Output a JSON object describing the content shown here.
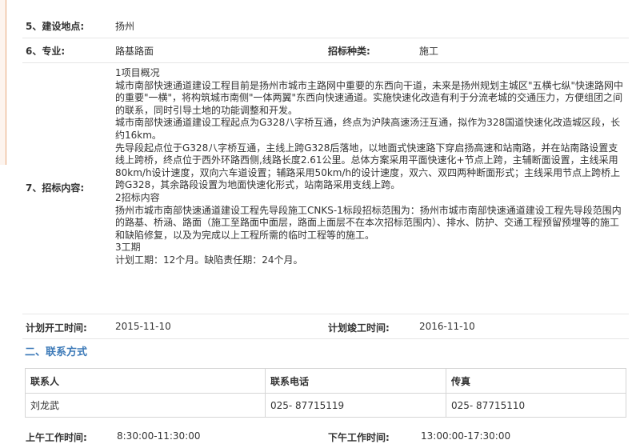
{
  "fields": {
    "location": {
      "label": "5、建设地点:",
      "value": "扬州"
    },
    "major": {
      "label": "6、专业:",
      "value": "路基路面"
    },
    "bid_type": {
      "label": "招标种类:",
      "value": "施工"
    },
    "content": {
      "label": "7、招标内容:",
      "paragraphs": [
        "1项目概况",
        "城市南部快速通道建设工程目前是扬州市城市主路网中重要的东西向干道，未来是扬州规划主城区\"五横七纵\"快速路网中的重要\"一横\"，将构筑城市南侧\"一体两翼\"东西向快速通道。实施快速化改造有利于分流老城的交通压力，方便组团之间的联系，同时引导土地的功能调整和开发。",
        "城市南部快速通道建设工程起点为G328八字桥互通，终点为沪陕高速汤汪互通，拟作为328国道快速化改造城区段，长约16km。",
        "先导段起点位于G328八字桥互通，主线上跨G328后落地，以地面式快速路下穿启扬高速和站南路，并在站南路设置支线上跨桥，终点位于西外环路西侧,线路长度2.61公里。总体方案采用平面快速化+节点上跨，主辅断面设置，主线采用80km/h设计速度，双向六车道设置；辅路采用50km/h的设计速度，双六、双四两种断面形式；主线采用节点上跨桥上跨G328，其余路段设置为地面快速化形式，站南路采用支线上跨。",
        "2招标内容",
        "扬州市城市南部快速通道建设工程先导段施工CNKS-1标段招标范围为：扬州市城市南部快速通道建设工程先导段范围内的路基、桥涵、路面（施工至路面中面层，路面上面层不在本次招标范围内）、排水、防护、交通工程预留预埋等的施工和缺陷修复，以及为完成以上工程所需的临时工程等的施工。",
        "3工期",
        "计划工期：12个月。缺陷责任期：24个月。"
      ]
    },
    "plan_start": {
      "label": "计划开工时间:",
      "value": "2015-11-10"
    },
    "plan_end": {
      "label": "计划竣工时间:",
      "value": "2016-11-10"
    }
  },
  "contact": {
    "section_title": "二、联系方式",
    "headers": [
      "联系人",
      "联系电话",
      "传真"
    ],
    "rows": [
      [
        "刘龙武",
        "025- 87715119",
        "025- 87715110"
      ]
    ]
  },
  "hours": {
    "am": {
      "label": "上午工作时间:",
      "value": "8:30:00-11:30:00"
    },
    "pm": {
      "label": "下午工作时间:",
      "value": "13:00:00-17:30:00"
    }
  }
}
